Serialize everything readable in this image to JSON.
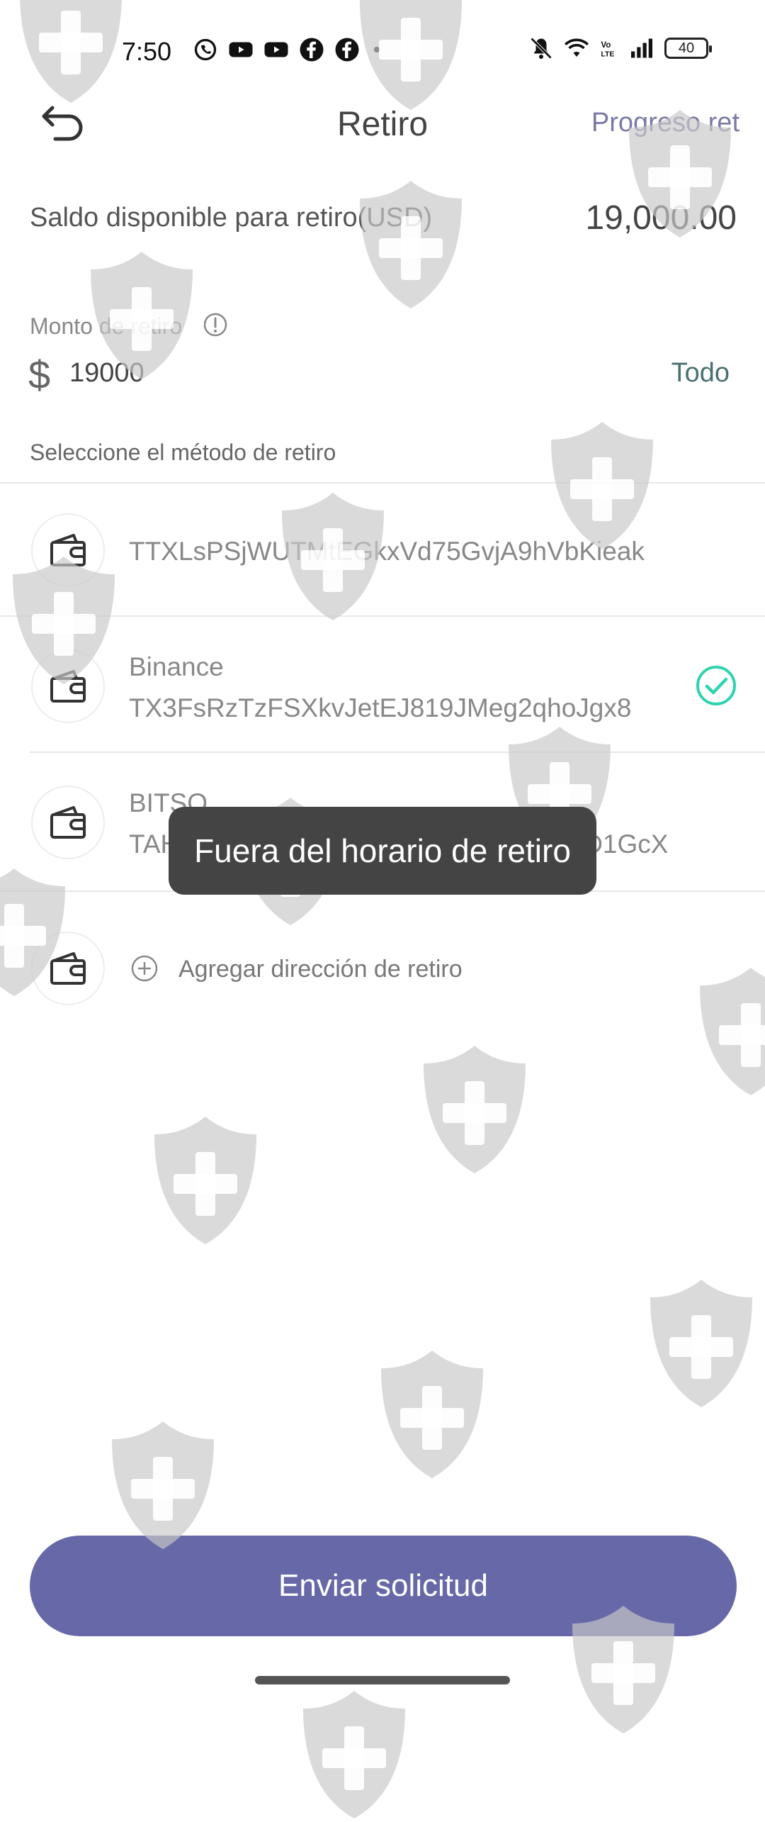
{
  "status_bar": {
    "time": "7:50",
    "battery": "40",
    "left_icons": [
      "whatsapp-icon",
      "youtube-icon",
      "youtube-icon",
      "facebook-icon",
      "facebook-icon",
      "dot-icon"
    ],
    "right_icons": [
      "bell-muted-icon",
      "wifi-icon",
      "volte-icon",
      "signal-icon",
      "battery-icon"
    ]
  },
  "header": {
    "title": "Retiro",
    "progress_link": "Progreso ret"
  },
  "balance": {
    "label": "Saldo disponible para retiro(USD)",
    "value": "19,000.00"
  },
  "amount": {
    "label": "Monto de retiro",
    "currency_symbol": "$",
    "value": "19000",
    "all_label": "Todo"
  },
  "method_section": {
    "label": "Seleccione el método de retiro",
    "wallets": [
      {
        "name": "",
        "address": "TTXLsPSjWUTMtEGkxVd75GvjA9hVbKieak",
        "selected": false
      },
      {
        "name": "Binance",
        "address": "TX3FsRzTzFSXkvJetEJ819JMeg2qhoJgx8",
        "selected": true
      },
      {
        "name": "BITSO",
        "address": "TAHbQYe...3r...Hpe...WeHMTHG...dv...D1GcX",
        "selected": false
      }
    ],
    "add_label": "Agregar dirección de retiro"
  },
  "toast": "Fuera del horario de retiro",
  "submit_label": "Enviar solicitud",
  "colors": {
    "accent": "#6768a8",
    "link": "#7a7aa6",
    "todo": "#4a7070",
    "check": "#2ed3b0",
    "toast_bg": "#444444"
  }
}
